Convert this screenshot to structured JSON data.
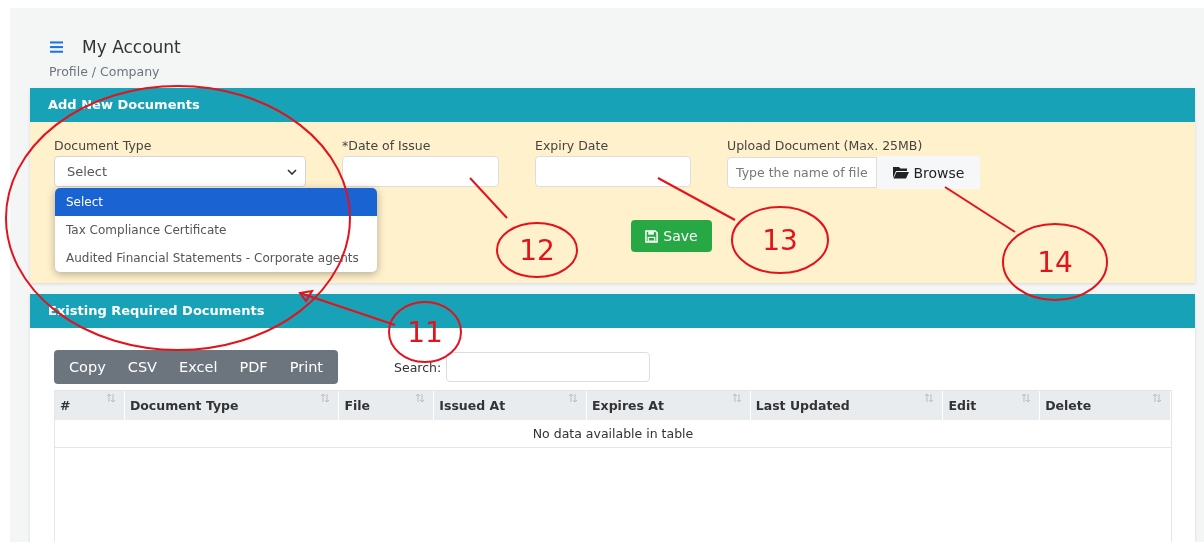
{
  "header": {
    "title": "My Account",
    "breadcrumb": "Profile / Company"
  },
  "add_card": {
    "title": "Add New Documents",
    "fields": [
      {
        "kind": "select",
        "label": "Document Type",
        "value": "Select"
      },
      {
        "kind": "date",
        "label": "*Date of Issue"
      },
      {
        "kind": "date",
        "label": "Expiry Date"
      },
      {
        "kind": "file",
        "label": "Upload Document (Max. 25MB)",
        "placeholder": "Type the name of file",
        "button": "Browse"
      }
    ],
    "dropdown": [
      {
        "label": "Select",
        "selected": true
      },
      {
        "label": "Tax Compliance Certificate",
        "selected": false
      },
      {
        "label": "Audited Financial Statements - Corporate agents",
        "selected": false
      }
    ],
    "save_button": "Save"
  },
  "docs_card": {
    "title": "Existing Required Documents",
    "export_buttons": [
      "Copy",
      "CSV",
      "Excel",
      "PDF",
      "Print"
    ],
    "search_label": "Search:",
    "columns": [
      "#",
      "Document Type",
      "File",
      "Issued At",
      "Expires At",
      "Last Updated",
      "Edit",
      "Delete"
    ],
    "empty_message": "No data available in table"
  },
  "annotations": [
    {
      "label": "11"
    },
    {
      "label": "12"
    },
    {
      "label": "13"
    },
    {
      "label": "14"
    }
  ]
}
